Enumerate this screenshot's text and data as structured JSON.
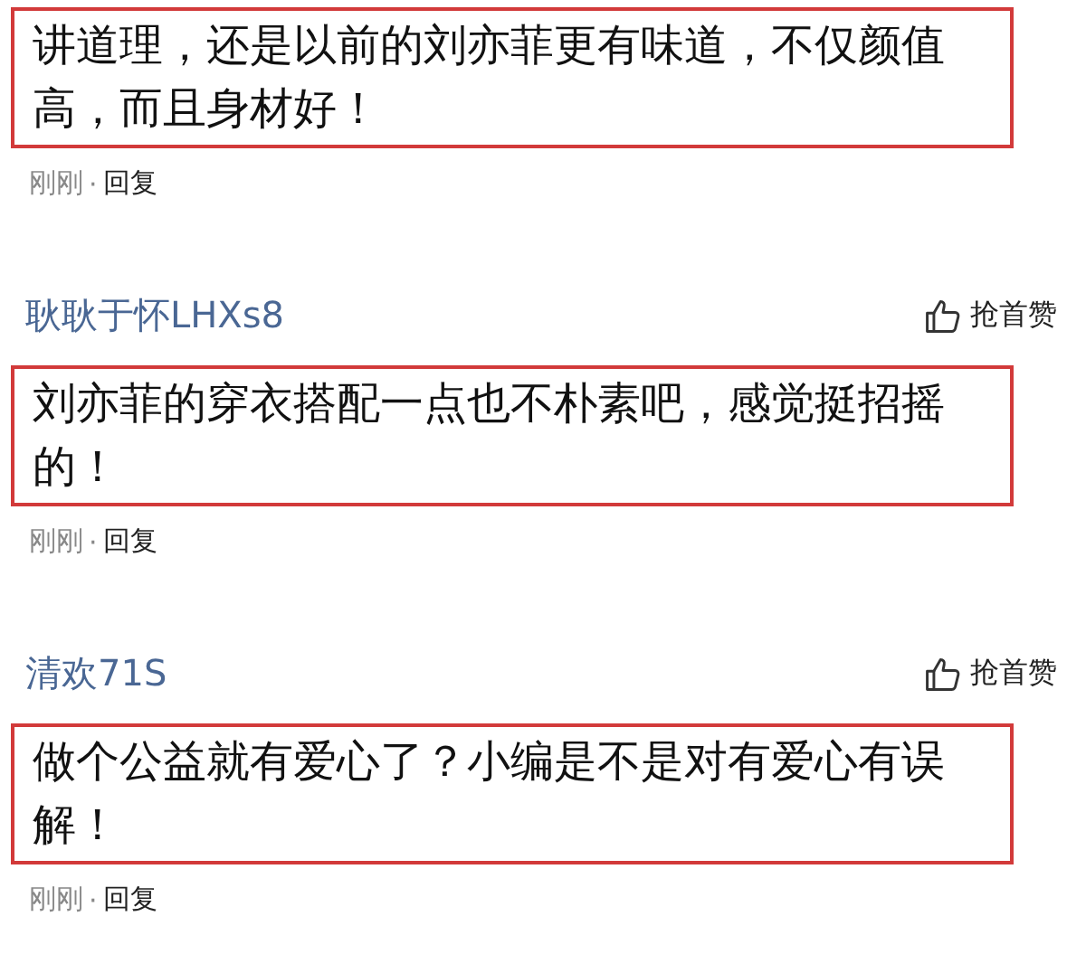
{
  "comments": [
    {
      "text": "讲道理，还是以前的刘亦菲更有味道，不仅颜值高，而且身材好！",
      "highlighted": true,
      "time": "刚刚",
      "separator": "·",
      "reply": "回复"
    },
    {
      "author": "耿耿于怀LHXs8",
      "like": "抢首赞",
      "text": "刘亦菲的穿衣搭配一点也不朴素吧，感觉挺招摇的！",
      "highlighted": true,
      "time": "刚刚",
      "separator": "·",
      "reply": "回复"
    },
    {
      "author": "清欢71S",
      "like": "抢首赞",
      "text": "做个公益就有爱心了？小编是不是对有爱心有误解！",
      "highlighted": true,
      "time": "刚刚",
      "separator": "·",
      "reply": "回复"
    }
  ]
}
